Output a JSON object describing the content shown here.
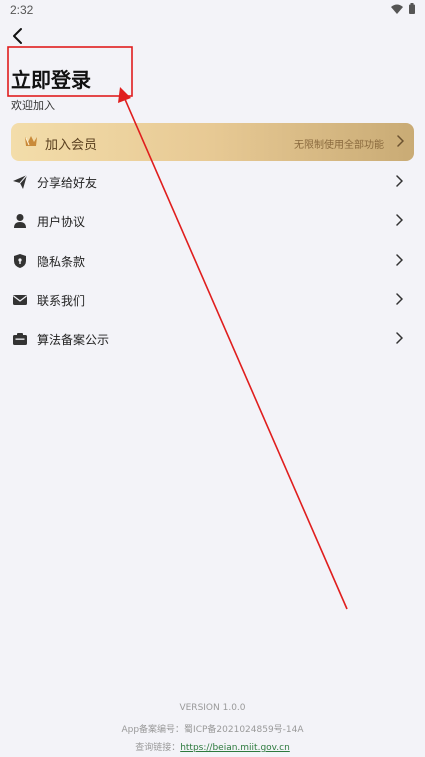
{
  "status_bar": {
    "time": "2:32"
  },
  "header": {
    "login_title": "立即登录",
    "welcome": "欢迎加入"
  },
  "vip": {
    "label": "加入会员",
    "description": "无限制使用全部功能"
  },
  "menu": {
    "items": [
      {
        "label": "分享给好友",
        "icon": "send-icon"
      },
      {
        "label": "用户协议",
        "icon": "user-icon"
      },
      {
        "label": "隐私条款",
        "icon": "shield-icon"
      },
      {
        "label": "联系我们",
        "icon": "mail-icon"
      },
      {
        "label": "算法备案公示",
        "icon": "card-icon"
      }
    ]
  },
  "footer": {
    "version": "VERSION 1.0.0",
    "record_label": "App备案编号：",
    "record_number": "蜀ICP备2021024859号-14A",
    "query_label": "查询链接：",
    "query_link": "https://beian.miit.gov.cn"
  },
  "colors": {
    "background": "#f3f3f8",
    "vip_gradient_start": "#f3ddaa",
    "vip_gradient_end": "#c9ab75",
    "annotation_red": "#e01e1e",
    "link_green": "#2d7a3e"
  }
}
